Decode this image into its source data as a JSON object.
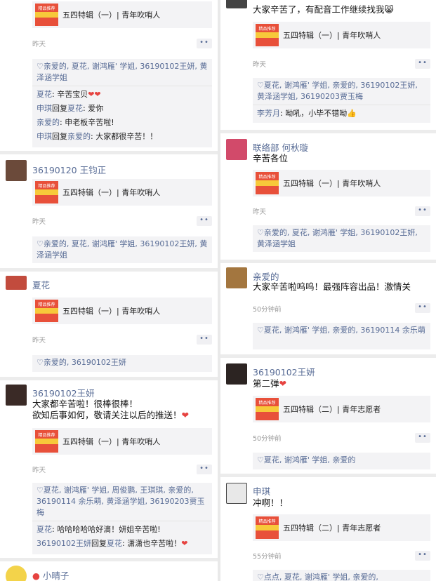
{
  "share_title_1": "五四特辑（一）| 青年吹哨人",
  "share_title_2": "五四特辑（二）| 青年志愿者",
  "thumb_label": "精品推荐",
  "more_label": "••",
  "left": {
    "p0": {
      "time": "昨天",
      "likes": "♡亲爱的, 夏花, 谢鸿雁' 学姐, 36190102王妍, 黄泽涵学姐",
      "comments": [
        {
          "name": "夏花",
          "mid": "",
          "name2": "",
          "text": ": 辛苦宝贝",
          "suffix": "❤❤"
        },
        {
          "name": "申琪",
          "mid": "回复",
          "name2": "夏花",
          "text": ": 爱你",
          "suffix": ""
        },
        {
          "name": "亲爱的",
          "mid": "",
          "name2": "",
          "text": ": 申老板辛苦啦!",
          "suffix": ""
        },
        {
          "name": "申琪",
          "mid": "回复",
          "name2": "亲爱的",
          "text": ": 大家都很辛苦！！",
          "suffix": ""
        }
      ]
    },
    "p1": {
      "name": "36190120 王钧正",
      "time": "昨天",
      "likes": "♡亲爱的, 夏花, 谢鸿雁' 学姐, 36190102王妍, 黄泽涵学姐"
    },
    "p2": {
      "name": "夏花",
      "time": "昨天",
      "likes": "♡亲爱的, 36190102王妍"
    },
    "p3": {
      "name": "36190102王妍",
      "text1": "大家都辛苦啦！很棒很棒！",
      "text2": "欲知后事如何，敬请关注以后的推送！",
      "heart": "❤",
      "time": "昨天",
      "likes": "♡夏花, 谢鸿雁' 学姐, 周俊鹏, 王琪琪, 亲爱的, 36190114 余乐萌, 黄泽涵学姐, 36190203贾玉梅",
      "comments": [
        {
          "name": "夏花",
          "mid": "",
          "name2": "",
          "text": ": 哈哈哈哈哈好滴！妍姐辛苦啦!",
          "suffix": ""
        },
        {
          "name": "36190102王妍",
          "mid": "回复",
          "name2": "夏花",
          "text": ": 潇潇也辛苦啦！",
          "suffix": "❤"
        }
      ]
    },
    "p4": {
      "name": "小晴子"
    }
  },
  "right": {
    "p0": {
      "text": "大家辛苦了，有配音工作继续找我",
      "emoji": "😸",
      "time": "昨天",
      "likes": "♡夏花, 谢鸿雁' 学姐, 亲爱的, 36190102王妍, 黄泽涵学姐, 36190203贾玉梅",
      "comments": [
        {
          "name": "李芳月",
          "mid": "",
          "name2": "",
          "text": ": 呦吼，小毕不错呦",
          "suffix": "👍"
        }
      ]
    },
    "p1": {
      "name": "联络部 何秋璇",
      "text": "辛苦各位",
      "time": "昨天",
      "likes": "♡亲爱的, 夏花, 谢鸿雁' 学姐, 36190102王妍, 黄泽涵学姐"
    },
    "p2": {
      "name": "亲爱的",
      "text": "大家辛苦啦呜呜！最强阵容出品！激情关",
      "time": "50分钟前",
      "likes": "♡夏花, 谢鸿雁' 学姐, 亲爱的, 36190114 余乐萌"
    },
    "p3": {
      "name": "36190102王妍",
      "text": "第二弹",
      "heart": "❤",
      "time": "50分钟前",
      "likes": "♡夏花, 谢鸿雁' 学姐, 亲爱的"
    },
    "p4": {
      "name": "申琪",
      "text": "冲啊！！",
      "time": "55分钟前",
      "likes": "♡点点, 夏花, 谢鸿雁' 学姐, 亲爱的,"
    }
  }
}
